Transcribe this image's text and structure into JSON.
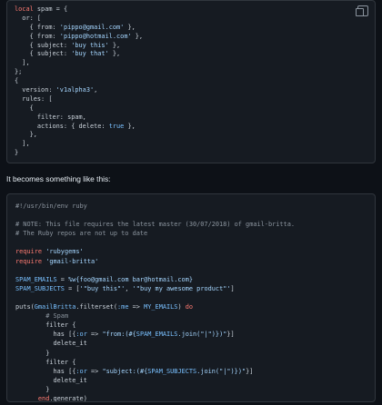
{
  "block1": {
    "lines": [
      [
        {
          "t": "local",
          "c": "k"
        },
        {
          "t": " spam = {",
          "c": "p"
        }
      ],
      [
        {
          "t": "  or: [",
          "c": "p"
        }
      ],
      [
        {
          "t": "    { from: ",
          "c": "p"
        },
        {
          "t": "'pippo@gmail.com'",
          "c": "s"
        },
        {
          "t": " },",
          "c": "p"
        }
      ],
      [
        {
          "t": "    { from: ",
          "c": "p"
        },
        {
          "t": "'pippo@hotmail.com'",
          "c": "s"
        },
        {
          "t": " },",
          "c": "p"
        }
      ],
      [
        {
          "t": "    { subject: ",
          "c": "p"
        },
        {
          "t": "'buy this'",
          "c": "s"
        },
        {
          "t": " },",
          "c": "p"
        }
      ],
      [
        {
          "t": "    { subject: ",
          "c": "p"
        },
        {
          "t": "'buy that'",
          "c": "s"
        },
        {
          "t": " },",
          "c": "p"
        }
      ],
      [
        {
          "t": "  ],",
          "c": "p"
        }
      ],
      [
        {
          "t": "};",
          "c": "p"
        }
      ],
      [
        {
          "t": "{",
          "c": "p"
        }
      ],
      [
        {
          "t": "  version: ",
          "c": "p"
        },
        {
          "t": "'v1alpha3'",
          "c": "s"
        },
        {
          "t": ",",
          "c": "p"
        }
      ],
      [
        {
          "t": "  rules: [",
          "c": "p"
        }
      ],
      [
        {
          "t": "    {",
          "c": "p"
        }
      ],
      [
        {
          "t": "      filter: spam,",
          "c": "p"
        }
      ],
      [
        {
          "t": "      actions: { delete: ",
          "c": "p"
        },
        {
          "t": "true",
          "c": "n"
        },
        {
          "t": " },",
          "c": "p"
        }
      ],
      [
        {
          "t": "    },",
          "c": "p"
        }
      ],
      [
        {
          "t": "  ],",
          "c": "p"
        }
      ],
      [
        {
          "t": "}",
          "c": "p"
        }
      ]
    ]
  },
  "prose": "It becomes something like this:",
  "block2": {
    "lines": [
      [
        {
          "t": "#!/usr/bin/env ruby",
          "c": "c"
        }
      ],
      [],
      [
        {
          "t": "# NOTE: This file requires the latest master (30/07/2018) of gmail-britta.",
          "c": "c"
        }
      ],
      [
        {
          "t": "# The Ruby repos are not up to date",
          "c": "c"
        }
      ],
      [],
      [
        {
          "t": "require",
          "c": "k"
        },
        {
          "t": " ",
          "c": "p"
        },
        {
          "t": "'rubygems'",
          "c": "s"
        }
      ],
      [
        {
          "t": "require",
          "c": "k"
        },
        {
          "t": " ",
          "c": "p"
        },
        {
          "t": "'gmail-britta'",
          "c": "s"
        }
      ],
      [],
      [
        {
          "t": "SPAM_EMAILS",
          "c": "n"
        },
        {
          "t": " = ",
          "c": "p"
        },
        {
          "t": "%w{foo@gmail.com bar@hotmail.com}",
          "c": "s"
        }
      ],
      [
        {
          "t": "SPAM_SUBJECTS",
          "c": "n"
        },
        {
          "t": " = [",
          "c": "p"
        },
        {
          "t": "'\"buy this\"'",
          "c": "s"
        },
        {
          "t": ", ",
          "c": "p"
        },
        {
          "t": "'\"buy my awesome product\"'",
          "c": "s"
        },
        {
          "t": "]",
          "c": "p"
        }
      ],
      [],
      [
        {
          "t": "puts(",
          "c": "p"
        },
        {
          "t": "GmailBritta",
          "c": "n"
        },
        {
          "t": ".filterset(",
          "c": "p"
        },
        {
          "t": ":me",
          "c": "n"
        },
        {
          "t": " => ",
          "c": "p"
        },
        {
          "t": "MY_EMAILS",
          "c": "n"
        },
        {
          "t": ") ",
          "c": "p"
        },
        {
          "t": "do",
          "c": "k"
        }
      ],
      [
        {
          "t": "        ",
          "c": "p"
        },
        {
          "t": "# Spam",
          "c": "c"
        }
      ],
      [
        {
          "t": "        filter {",
          "c": "p"
        }
      ],
      [
        {
          "t": "          has [{",
          "c": "p"
        },
        {
          "t": ":or",
          "c": "n"
        },
        {
          "t": " => ",
          "c": "p"
        },
        {
          "t": "\"from:(#{",
          "c": "s"
        },
        {
          "t": "SPAM_EMAILS",
          "c": "n"
        },
        {
          "t": ".join(\"|\")})\"",
          "c": "s"
        },
        {
          "t": "}]",
          "c": "p"
        }
      ],
      [
        {
          "t": "          delete_it",
          "c": "p"
        }
      ],
      [
        {
          "t": "        }",
          "c": "p"
        }
      ],
      [
        {
          "t": "        filter {",
          "c": "p"
        }
      ],
      [
        {
          "t": "          has [{",
          "c": "p"
        },
        {
          "t": ":or",
          "c": "n"
        },
        {
          "t": " => ",
          "c": "p"
        },
        {
          "t": "\"subject:(#{",
          "c": "s"
        },
        {
          "t": "SPAM_SUBJECTS",
          "c": "n"
        },
        {
          "t": ".join(\"|\")})\"",
          "c": "s"
        },
        {
          "t": "}]",
          "c": "p"
        }
      ],
      [
        {
          "t": "          delete_it",
          "c": "p"
        }
      ],
      [
        {
          "t": "        }",
          "c": "p"
        }
      ],
      [
        {
          "t": "      ",
          "c": "p"
        },
        {
          "t": "end",
          "c": "k"
        },
        {
          "t": ".generate)",
          "c": "p"
        }
      ]
    ]
  }
}
